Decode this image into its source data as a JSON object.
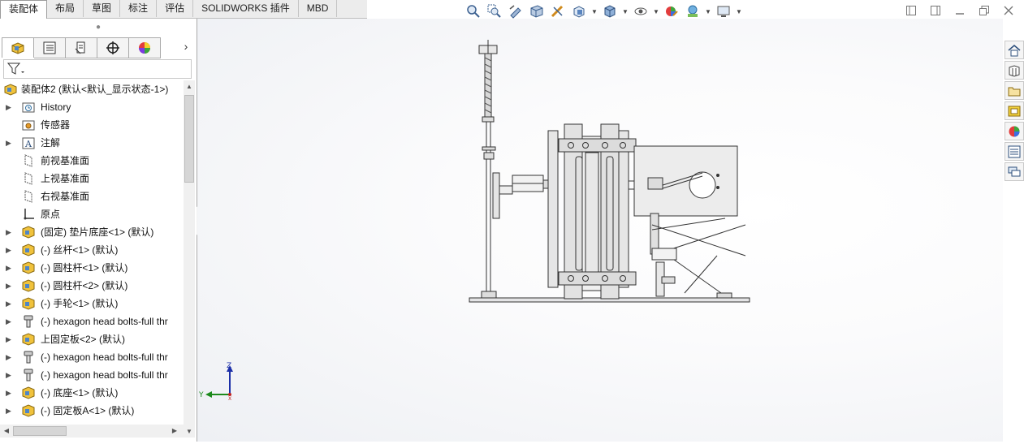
{
  "top_tabs": [
    "装配体",
    "布局",
    "草图",
    "标注",
    "评估",
    "SOLIDWORKS 插件",
    "MBD"
  ],
  "active_tab_index": 0,
  "view_toolbar": [
    "zoom-to-fit-icon",
    "zoom-area-icon",
    "previous-view-icon",
    "section-view-icon",
    "dynamic-annotation-icon",
    "view-orientation-icon",
    "display-style-icon",
    "hide-show-items-icon",
    "edit-appearance-icon",
    "apply-scene-icon",
    "view-settings-icon"
  ],
  "tree": {
    "root": "装配体2  (默认<默认_显示状态-1>)",
    "items": [
      {
        "label": "History",
        "icon": "history-icon",
        "expandable": true
      },
      {
        "label": "传感器",
        "icon": "sensor-icon",
        "expandable": false
      },
      {
        "label": "注解",
        "icon": "annotation-icon",
        "expandable": true
      },
      {
        "label": "前视基准面",
        "icon": "plane-icon",
        "expandable": false
      },
      {
        "label": "上视基准面",
        "icon": "plane-icon",
        "expandable": false
      },
      {
        "label": "右视基准面",
        "icon": "plane-icon",
        "expandable": false
      },
      {
        "label": "原点",
        "icon": "origin-icon",
        "expandable": false
      },
      {
        "label": "(固定) 垫片底座<1> (默认)",
        "icon": "part-icon",
        "expandable": true
      },
      {
        "label": "(-) 丝杆<1> (默认)",
        "icon": "part-icon",
        "expandable": true
      },
      {
        "label": "(-) 圆柱杆<1> (默认)",
        "icon": "part-icon",
        "expandable": true
      },
      {
        "label": "(-) 圆柱杆<2> (默认)",
        "icon": "part-icon",
        "expandable": true
      },
      {
        "label": "(-) 手轮<1> (默认)",
        "icon": "part-icon",
        "expandable": true
      },
      {
        "label": "(-) hexagon head bolts-full thr",
        "icon": "bolt-icon",
        "expandable": true
      },
      {
        "label": "上固定板<2> (默认)",
        "icon": "part-icon",
        "expandable": true
      },
      {
        "label": "(-) hexagon head bolts-full thr",
        "icon": "bolt-icon",
        "expandable": true
      },
      {
        "label": "(-) hexagon head bolts-full thr",
        "icon": "bolt-icon",
        "expandable": true
      },
      {
        "label": "(-) 底座<1> (默认)",
        "icon": "part-icon",
        "expandable": true
      },
      {
        "label": "(-) 固定板A<1> (默认)",
        "icon": "part-icon",
        "expandable": true
      }
    ]
  },
  "triad": {
    "z": "Z",
    "y": "Y",
    "x": "X"
  },
  "right_taskpane": [
    "home-icon",
    "design-library-icon",
    "file-explorer-icon",
    "view-palette-icon",
    "appearances-icon",
    "custom-properties-icon",
    "forum-icon"
  ]
}
